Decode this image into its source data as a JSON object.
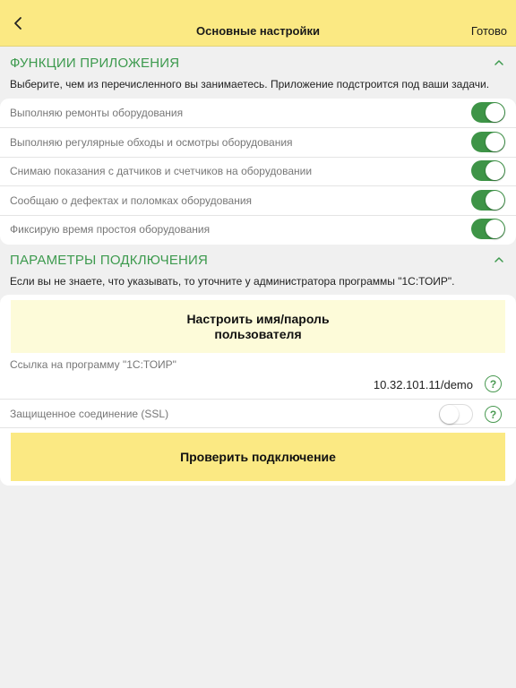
{
  "navbar": {
    "title": "Основные настройки",
    "done_label": "Готово",
    "back_icon": "chevron-left-icon"
  },
  "functions": {
    "title": "ФУНКЦИИ ПРИЛОЖЕНИЯ",
    "description": "Выберите, чем из перечисленного вы занимаетесь. Приложение подстроится под ваши задачи.",
    "items": [
      {
        "label": "Выполняю ремонты оборудования",
        "enabled": true
      },
      {
        "label": "Выполняю регулярные обходы и осмотры оборудования",
        "enabled": true
      },
      {
        "label": "Снимаю показания с датчиков и счетчиков на оборудовании",
        "enabled": true
      },
      {
        "label": "Сообщаю о дефектах и поломках оборудования",
        "enabled": true
      },
      {
        "label": "Фиксирую время простоя оборудования",
        "enabled": true
      }
    ]
  },
  "connection": {
    "title": "ПАРАМЕТРЫ ПОДКЛЮЧЕНИЯ",
    "description": "Если вы не знаете, что указывать, то уточните у администратора программы \"1С:ТОИР\".",
    "credentials_button": "Настроить имя/пароль\nпользователя",
    "url_label": "Ссылка на программу \"1С:ТОИР\"",
    "url_value": "10.32.101.11/demo",
    "ssl_label": "Защищенное соединение (SSL)",
    "ssl_enabled": false,
    "check_button": "Проверить подключение",
    "help_symbol": "?"
  },
  "colors": {
    "accent_green": "#3e9447",
    "header_yellow": "#fbe983",
    "button_yellow": "#fbe983",
    "button_light_yellow": "#fdfbd9"
  }
}
